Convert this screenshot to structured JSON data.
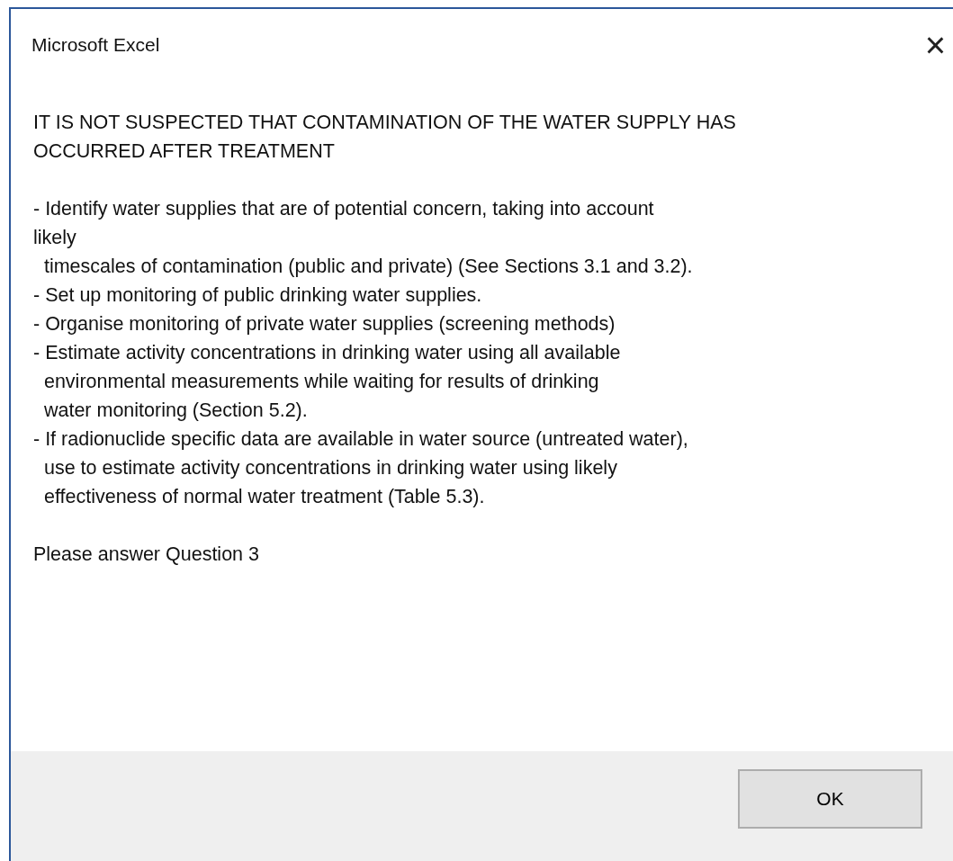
{
  "window": {
    "title": "Microsoft Excel",
    "close": "×"
  },
  "message": {
    "paragraphs": [
      [
        "IT IS NOT SUSPECTED THAT CONTAMINATION OF THE WATER SUPPLY HAS",
        "OCCURRED AFTER TREATMENT"
      ],
      [
        "- Identify water supplies that are of potential concern, taking into account",
        "likely",
        "  timescales of contamination (public and private) (See Sections 3.1 and 3.2).",
        "- Set up monitoring of public drinking water supplies.",
        "- Organise monitoring of private water supplies (screening methods)",
        "- Estimate activity concentrations in drinking water using all available",
        "  environmental measurements while waiting for results of drinking",
        "  water monitoring (Section 5.2).",
        "- If radionuclide specific data are available in water source (untreated water),",
        "  use to estimate activity concentrations in drinking water using likely",
        "  effectiveness of normal water treatment (Table 5.3)."
      ],
      [
        "Please answer Question 3"
      ]
    ]
  },
  "buttons": [
    "OK"
  ]
}
